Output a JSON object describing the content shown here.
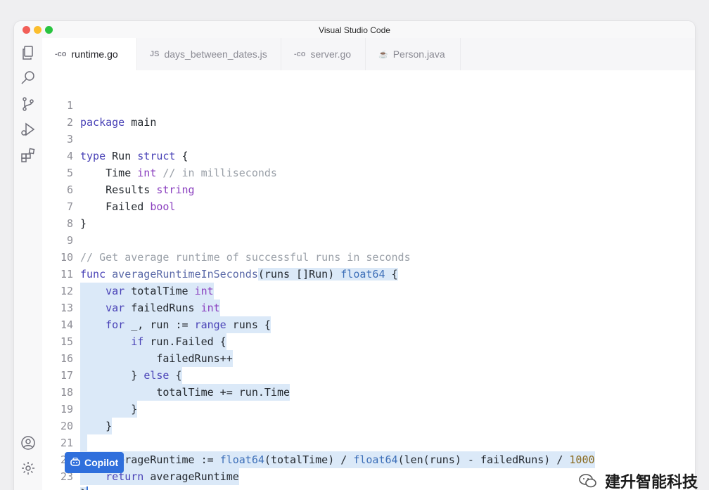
{
  "window": {
    "title": "Visual Studio Code"
  },
  "tabs": [
    {
      "icon": "-co",
      "label": "runtime.go"
    },
    {
      "icon": "JS",
      "label": "days_between_dates.js"
    },
    {
      "icon": "-co",
      "label": "server.go"
    },
    {
      "icon": "☕",
      "label": "Person.java"
    }
  ],
  "activity_icons": [
    "files-icon",
    "search-icon",
    "source-control-icon",
    "run-debug-icon",
    "extensions-icon",
    "account-icon",
    "settings-gear-icon"
  ],
  "code": {
    "line_numbers": [
      "1",
      "2",
      "3",
      "4",
      "5",
      "6",
      "7",
      "8",
      "9",
      "10",
      "11",
      "12",
      "13",
      "14",
      "15",
      "16",
      "17",
      "18",
      "19",
      "20",
      "21",
      "22",
      "23"
    ],
    "l1": {
      "kw": "package",
      "rest": " main"
    },
    "l3": {
      "kw1": "type",
      "name": " Run ",
      "kw2": "struct",
      "rest": " {"
    },
    "l4": {
      "indent": "    ",
      "field": "Time ",
      "type": "int",
      "comment": " // in milliseconds"
    },
    "l5": {
      "indent": "    ",
      "field": "Results ",
      "type": "string"
    },
    "l6": {
      "indent": "    ",
      "field": "Failed ",
      "type": "bool"
    },
    "l7": {
      "text": "}"
    },
    "l9": {
      "comment": "// Get average runtime of successful runs in seconds"
    },
    "l10": {
      "kw": "func",
      "name": " averageRuntimeInSeconds",
      "params": "(runs []Run) ",
      "ret": "float64",
      "rest": " {"
    },
    "l11": {
      "indent": "    ",
      "kw": "var",
      "name": " totalTime ",
      "type": "int"
    },
    "l12": {
      "indent": "    ",
      "kw": "var",
      "name": " failedRuns ",
      "type": "int"
    },
    "l13": {
      "indent": "    ",
      "kw": "for",
      "a": " _, run := ",
      "kw2": "range",
      "b": " runs {"
    },
    "l14": {
      "indent": "        ",
      "kw": "if",
      "rest": " run.Failed {"
    },
    "l15": {
      "indent": "            ",
      "rest": "failedRuns++"
    },
    "l16": {
      "indent": "        ",
      "a": "} ",
      "kw": "else",
      "b": " {"
    },
    "l17": {
      "indent": "            ",
      "rest": "totalTime += run.Time"
    },
    "l18": {
      "indent": "        ",
      "rest": "}"
    },
    "l19": {
      "indent": "    ",
      "rest": "}"
    },
    "l21": {
      "indent": "    ",
      "a": "averageRuntime := ",
      "f1": "float64",
      "b": "(totalTime) / ",
      "f2": "float64",
      "c": "(len(runs) - failedRuns) / ",
      "num": "1000"
    },
    "l22": {
      "indent": "    ",
      "kw": "return",
      "rest": " averageRuntime"
    },
    "l23": {
      "text": "}"
    }
  },
  "copilot": {
    "icon": "copilot-icon",
    "label": "Copilot"
  },
  "watermark": {
    "text": "建升智能科技"
  }
}
